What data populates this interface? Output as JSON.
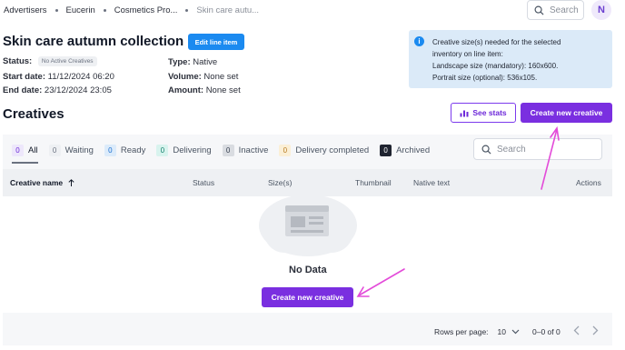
{
  "breadcrumb": {
    "items": [
      "Advertisers",
      "Eucerin",
      "Cosmetics Pro..."
    ],
    "current": "Skin care autu..."
  },
  "top_search": {
    "placeholder": "Search"
  },
  "user": {
    "initial": "N"
  },
  "line_item": {
    "title": "Skin care autumn collection",
    "edit_label": "Edit line item",
    "status_label": "Status:",
    "status_badge": "No Active Creatives",
    "start_label": "Start date:",
    "start_value": "11/12/2024 06:20",
    "end_label": "End date:",
    "end_value": "23/12/2024 23:05",
    "type_label": "Type:",
    "type_value": "Native",
    "volume_label": "Volume:",
    "volume_value": "None set",
    "amount_label": "Amount:",
    "amount_value": "None set"
  },
  "info": {
    "line1": "Creative size(s) needed for the selected",
    "line2": "inventory on line item:",
    "line3": "Landscape size (mandatory): 160x600.",
    "line4": "Portrait size (optional): 536x105."
  },
  "creatives": {
    "title": "Creatives",
    "see_stats_label": "See stats",
    "create_label": "Create new creative"
  },
  "tabs": [
    {
      "count": "0",
      "label": "All"
    },
    {
      "count": "0",
      "label": "Waiting"
    },
    {
      "count": "0",
      "label": "Ready"
    },
    {
      "count": "0",
      "label": "Delivering"
    },
    {
      "count": "0",
      "label": "Inactive"
    },
    {
      "count": "0",
      "label": "Delivery completed"
    },
    {
      "count": "0",
      "label": "Archived"
    }
  ],
  "table_search": {
    "placeholder": "Search"
  },
  "columns": {
    "creative_name": "Creative name",
    "status": "Status",
    "sizes": "Size(s)",
    "thumbnail": "Thumbnail",
    "native_text": "Native text",
    "actions": "Actions"
  },
  "empty": {
    "text": "No Data",
    "create_label": "Create new creative"
  },
  "pagination": {
    "rows_label": "Rows per page:",
    "rows_value": "10",
    "range": "0–0 of 0"
  },
  "colors": {
    "accent": "#7a2fe0",
    "edit_button": "#1b8af0",
    "info_bg": "#dbeaf8",
    "annotation_arrow": "#e34bd9"
  }
}
